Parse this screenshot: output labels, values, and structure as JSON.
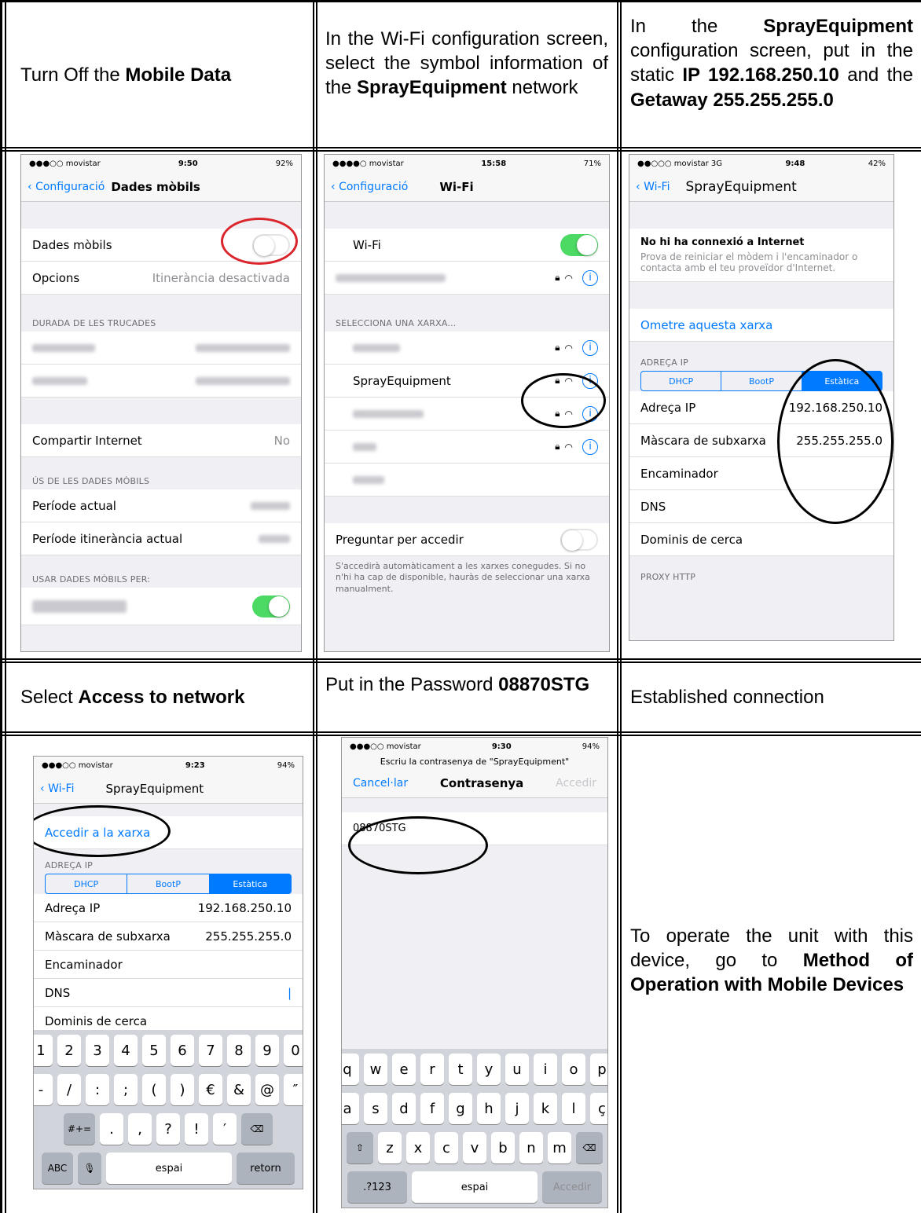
{
  "instructions": {
    "c1": {
      "pre": "Turn Off the ",
      "bold": "Mobile Data"
    },
    "c2": {
      "pre": "In the Wi-Fi configuration screen, select the symbol information of the ",
      "bold": "SprayEquipment",
      "post": " network"
    },
    "c3": {
      "pre": "In the ",
      "b1": "SprayEquipment",
      "mid1": " configuration screen, put in the static ",
      "b2": "IP 192.168.250.10",
      "mid2": " and the ",
      "b3": "Getaway 255.255.255.0"
    },
    "c4": {
      "pre": "Select ",
      "bold": "Access to network"
    },
    "c5": {
      "pre": "Put in the Password ",
      "bold": "08870STG"
    },
    "c6": {
      "text": "Established connection"
    },
    "c7": {
      "pre": "To operate the unit with this device, go to ",
      "bold": "Method of Operation with Mobile Devices"
    }
  },
  "screen1": {
    "carrier": "●●●○○ movistar",
    "time": "9:50",
    "battery": "92%",
    "back": "Configuració",
    "title": "Dades mòbils",
    "row_data": "Dades mòbils",
    "row_opts": "Opcions",
    "row_opts_val": "Itinerància desactivada",
    "sec_calls": "DURADA DE LES TRUCADES",
    "row_share": "Compartir Internet",
    "row_share_val": "No",
    "sec_usage": "ÚS DE LES DADES MÒBILS",
    "row_period": "Període actual",
    "row_roam": "Període itinerància actual",
    "sec_use_for": "USAR DADES MÒBILS PER:"
  },
  "screen2": {
    "carrier": "●●●●○ movistar",
    "time": "15:58",
    "battery": "71%",
    "back": "Configuració",
    "title": "Wi-Fi",
    "row_wifi": "Wi-Fi",
    "sec_select": "SELECCIONA UNA XARXA...",
    "net_spray": "SprayEquipment",
    "row_ask": "Preguntar per accedir",
    "note": "S'accedirà automàticament a les xarxes conegudes. Si no n'hi ha cap de disponible, hauràs de seleccionar una xarxa manualment."
  },
  "screen3": {
    "carrier": "●●○○○ movistar 3G",
    "time": "9:48",
    "battery": "42%",
    "back": "Wi-Fi",
    "title": "SprayEquipment",
    "nointernet": "No hi ha connexió a Internet",
    "nointernet_desc": "Prova de reiniciar el mòdem i l'encaminador o contacta amb el teu proveïdor d'Internet.",
    "forget": "Ometre aquesta xarxa",
    "sec_ip": "ADREÇA IP",
    "seg": [
      "DHCP",
      "BootP",
      "Estàtica"
    ],
    "ip_label": "Adreça IP",
    "ip_val": "192.168.250.10",
    "mask_label": "Màscara de subxarxa",
    "mask_val": "255.255.255.0",
    "router": "Encaminador",
    "dns": "DNS",
    "search": "Dominis de cerca",
    "sec_proxy": "PROXY HTTP"
  },
  "screen4": {
    "carrier": "●●●○○ movistar",
    "time": "9:23",
    "battery": "94%",
    "back": "Wi-Fi",
    "title": "SprayEquipment",
    "join": "Accedir a la xarxa",
    "sec_ip": "ADREÇA IP",
    "seg": [
      "DHCP",
      "BootP",
      "Estàtica"
    ],
    "ip_label": "Adreça IP",
    "ip_val": "192.168.250.10",
    "mask_label": "Màscara de subxarxa",
    "mask_val": "255.255.255.0",
    "router": "Encaminador",
    "dns": "DNS",
    "search": "Dominis de cerca",
    "keys1": [
      "1",
      "2",
      "3",
      "4",
      "5",
      "6",
      "7",
      "8",
      "9",
      "0"
    ],
    "keys2": [
      "-",
      "/",
      ":",
      ";",
      "(",
      ")",
      "€",
      "&",
      "@",
      "″"
    ],
    "keys3": [
      ".",
      ",",
      "?",
      "!",
      "′"
    ],
    "key_sym": "#+=",
    "key_abc": "ABC",
    "key_space": "espai",
    "key_return": "retorn"
  },
  "screen5": {
    "carrier": "●●●○○ movistar",
    "time": "9:30",
    "battery": "94%",
    "prompt": "Escriu la contrasenya de \"SprayEquipment\"",
    "cancel": "Cancel·lar",
    "title": "Contrasenya",
    "join": "Accedir",
    "password": "08870STG",
    "keys1": [
      "q",
      "w",
      "e",
      "r",
      "t",
      "y",
      "u",
      "i",
      "o",
      "p"
    ],
    "keys2": [
      "a",
      "s",
      "d",
      "f",
      "g",
      "h",
      "j",
      "k",
      "l",
      "ç"
    ],
    "keys3": [
      "z",
      "x",
      "c",
      "v",
      "b",
      "n",
      "m"
    ],
    "key_num": ".?123",
    "key_space": "espai",
    "key_join": "Accedir"
  }
}
